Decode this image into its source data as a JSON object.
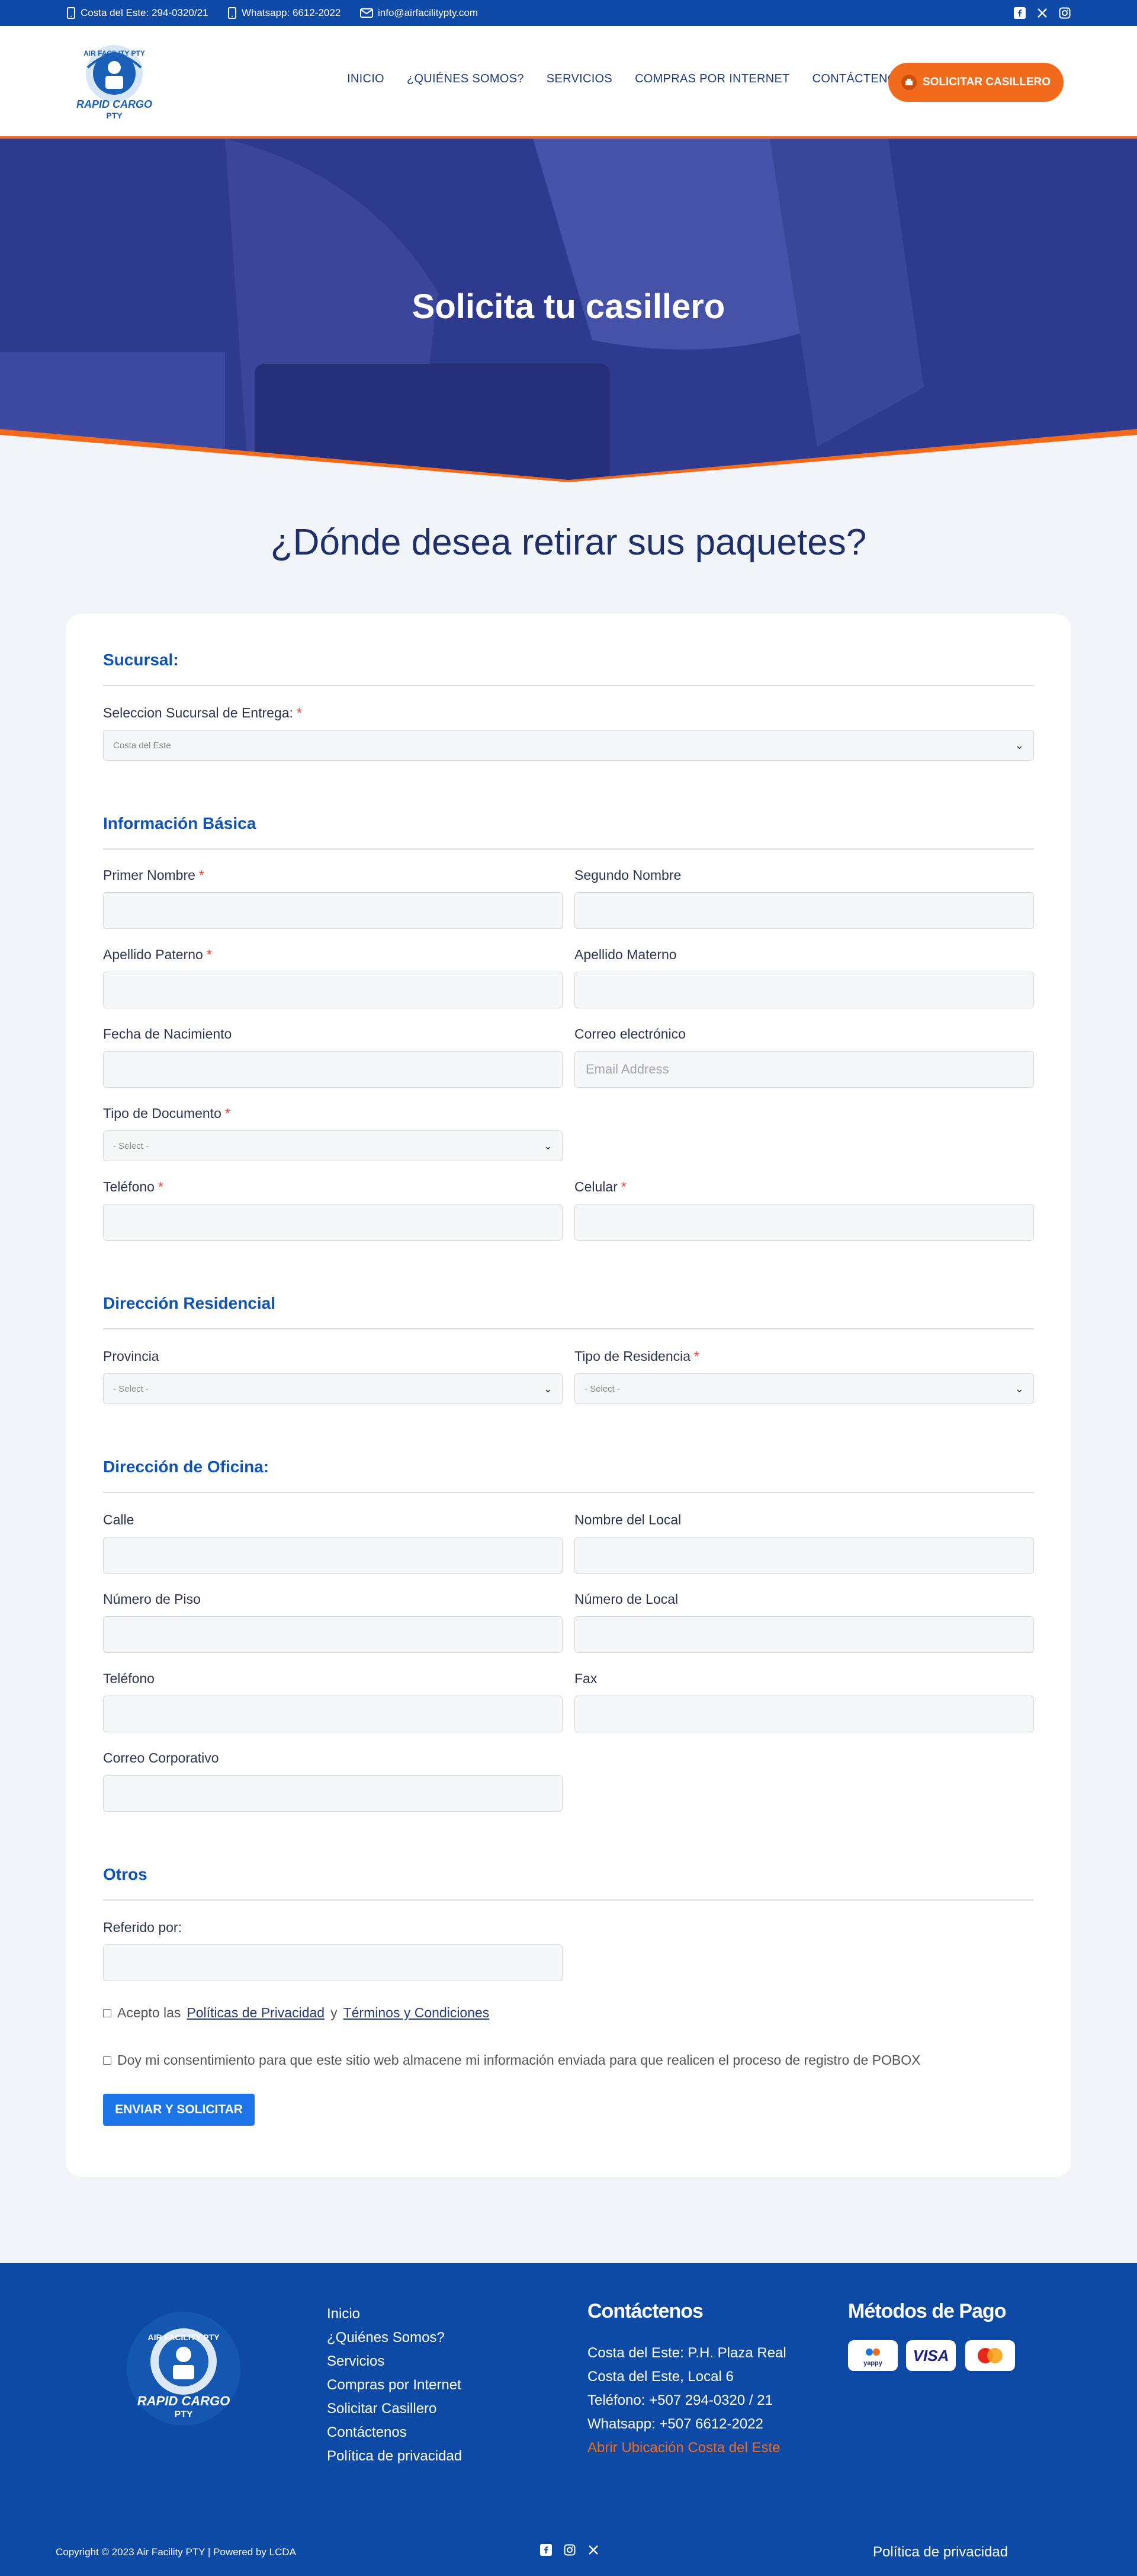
{
  "topbar": {
    "phone": "Costa del Este: 294-0320/21",
    "whatsapp": "Whatsapp: 6612-2022",
    "email": "info@airfacilitypty.com",
    "social_icons": [
      "facebook-icon",
      "x-icon",
      "instagram-icon"
    ]
  },
  "header": {
    "logo_text_top": "AIR FACILITY PTY",
    "logo_text_bottom": "RAPID CARGO",
    "logo_text_sub": "PTY",
    "nav": [
      "INICIO",
      "¿QUIÉNES SOMOS?",
      "SERVICIOS",
      "COMPRAS POR INTERNET",
      "CONTÁCTENOS"
    ],
    "cta": "SOLICITAR CASILLERO"
  },
  "hero": {
    "title": "Solicita tu casillero"
  },
  "page": {
    "heading": "¿Dónde desea retirar sus paquetes?"
  },
  "form": {
    "sucursal": {
      "title": "Sucursal:",
      "label": "Seleccion Sucursal de Entrega:",
      "value": "Costa del Este"
    },
    "basica": {
      "title": "Información Básica",
      "primer_nombre": "Primer Nombre",
      "segundo_nombre": "Segundo Nombre",
      "apellido_paterno": "Apellido Paterno",
      "apellido_materno": "Apellido Materno",
      "fecha_nacimiento": "Fecha de Nacimiento",
      "correo": "Correo electrónico",
      "correo_placeholder": "Email Address",
      "tipo_documento": "Tipo de Documento",
      "tipo_documento_value": "- Select -",
      "telefono": "Teléfono",
      "celular": "Celular"
    },
    "residencial": {
      "title": "Dirección Residencial",
      "provincia": "Provincia",
      "provincia_value": "- Select -",
      "tipo_residencia": "Tipo de Residencia",
      "tipo_residencia_value": "- Select -"
    },
    "oficina": {
      "title": "Dirección de Oficina:",
      "calle": "Calle",
      "nombre_local": "Nombre del Local",
      "numero_piso": "Número de Piso",
      "numero_local": "Número de Local",
      "telefono": "Teléfono",
      "fax": "Fax",
      "correo_corporativo": "Correo Corporativo"
    },
    "otros": {
      "title": "Otros",
      "referido": "Referido por:"
    },
    "terms": {
      "prefix": "Acepto las",
      "privacy": "Políticas de Privacidad",
      "and": "y",
      "conditions": "Términos y Condiciones"
    },
    "consent": "Doy mi consentimiento para que este sitio web almacene mi información enviada para que realicen el proceso de registro de POBOX",
    "submit": "ENVIAR Y SOLICITAR"
  },
  "footer": {
    "links": [
      "Inicio",
      "¿Quiénes Somos?",
      "Servicios",
      "Compras por Internet",
      "Solicitar Casillero",
      "Contáctenos",
      "Política de privacidad"
    ],
    "contact_title": "Contáctenos",
    "contact_lines": [
      "Costa del Este: P.H. Plaza Real",
      "Costa del Este, Local 6",
      "Teléfono: +507 294-0320 / 21",
      "Whatsapp: +507 6612-2022"
    ],
    "map_link": "Abrir Ubicación Costa del Este",
    "payment_title": "Métodos de Pago",
    "payment_methods": [
      "yappy",
      "VISA",
      "mastercard"
    ],
    "copyright": "Copyright © 2023 Air Facility PTY | Powered by LCDA",
    "privacy": "Política de privacidad"
  },
  "colors": {
    "brand_blue": "#0f4aa8",
    "accent_orange": "#f26a1b",
    "hero_overlay": "#2e3a8e",
    "submit_blue": "#1b75e8"
  }
}
